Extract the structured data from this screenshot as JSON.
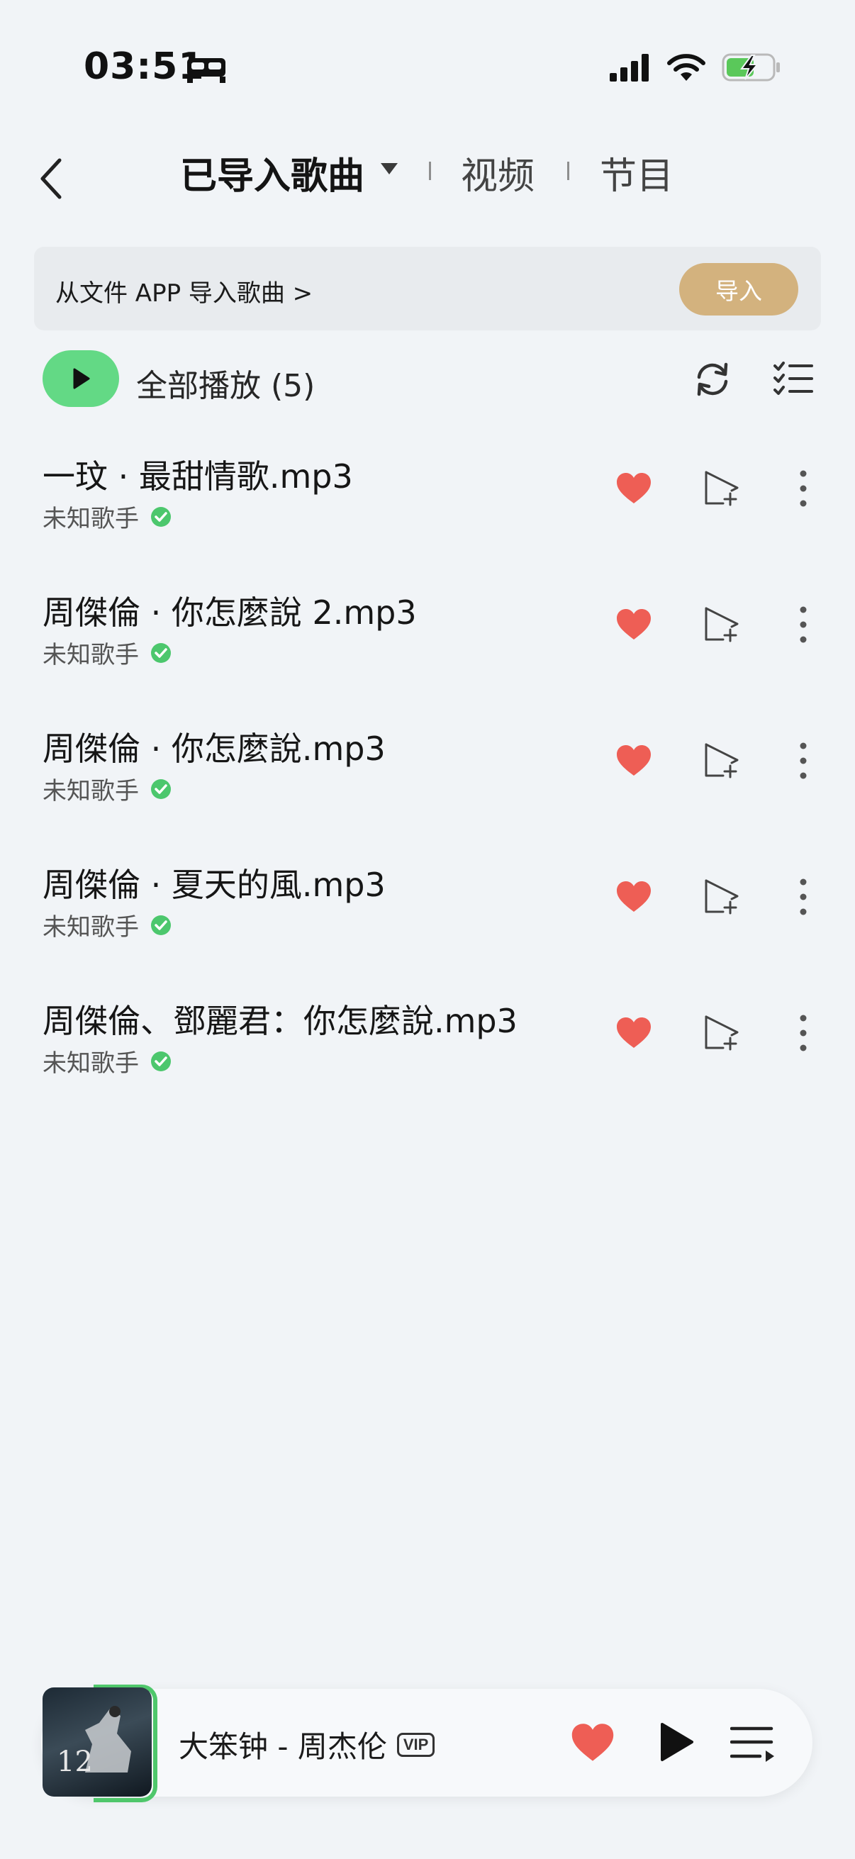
{
  "status_bar": {
    "time": "03:51",
    "icons": [
      "sleep-bed-icon",
      "cellular-signal-icon",
      "wifi-icon",
      "battery-charging-icon"
    ],
    "battery_color": "#5ac85a"
  },
  "header": {
    "tabs": [
      {
        "label": "已导入歌曲",
        "active": true
      },
      {
        "label": "视频",
        "active": false
      },
      {
        "label": "节目",
        "active": false
      }
    ]
  },
  "banner": {
    "text": "从文件 APP 导入歌曲 >",
    "button_label": "导入",
    "button_color": "#d3b27e"
  },
  "play_all": {
    "label": "全部播放 (5)",
    "accent_color": "#63d985"
  },
  "songs": [
    {
      "title": "一玟 · 最甜情歌.mp3",
      "artist": "未知歌手",
      "liked": true
    },
    {
      "title": "周傑倫 · 你怎麼說 2.mp3",
      "artist": "未知歌手",
      "liked": true
    },
    {
      "title": "周傑倫 · 你怎麼說.mp3",
      "artist": "未知歌手",
      "liked": true
    },
    {
      "title": "周傑倫 · 夏天的風.mp3",
      "artist": "未知歌手",
      "liked": true
    },
    {
      "title": "周傑倫、鄧麗君：你怎麼說.mp3",
      "artist": "未知歌手",
      "liked": true
    }
  ],
  "mini_player": {
    "title": "大笨钟 - 周杰伦",
    "badge": "VIP",
    "cover_number": "12",
    "heart_color": "#ee5e55"
  }
}
